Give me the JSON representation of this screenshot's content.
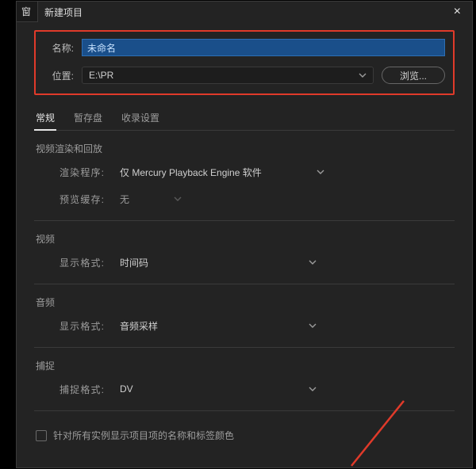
{
  "window": {
    "tab_hint": "窗",
    "title": "新建项目",
    "close_glyph": "×"
  },
  "form": {
    "name_label": "名称:",
    "name_value": "未命名",
    "location_label": "位置:",
    "location_value": "E:\\PR",
    "browse_label": "浏览..."
  },
  "tabs": {
    "general": "常规",
    "scratch": "暂存盘",
    "ingest": "收录设置"
  },
  "sections": {
    "render": {
      "title": "视频渲染和回放",
      "renderer_label": "渲染程序:",
      "renderer_value": "仅 Mercury Playback Engine 软件",
      "cache_label": "预览缓存:",
      "cache_value": "无"
    },
    "video": {
      "title": "视频",
      "format_label": "显示格式:",
      "format_value": "时间码"
    },
    "audio": {
      "title": "音频",
      "format_label": "显示格式:",
      "format_value": "音频采样"
    },
    "capture": {
      "title": "捕捉",
      "format_label": "捕捉格式:",
      "format_value": "DV"
    }
  },
  "checkbox": {
    "label": "针对所有实例显示项目项的名称和标签颜色"
  },
  "colors": {
    "highlight": "#e03a2a",
    "select_bg": "#1a4f8a"
  }
}
